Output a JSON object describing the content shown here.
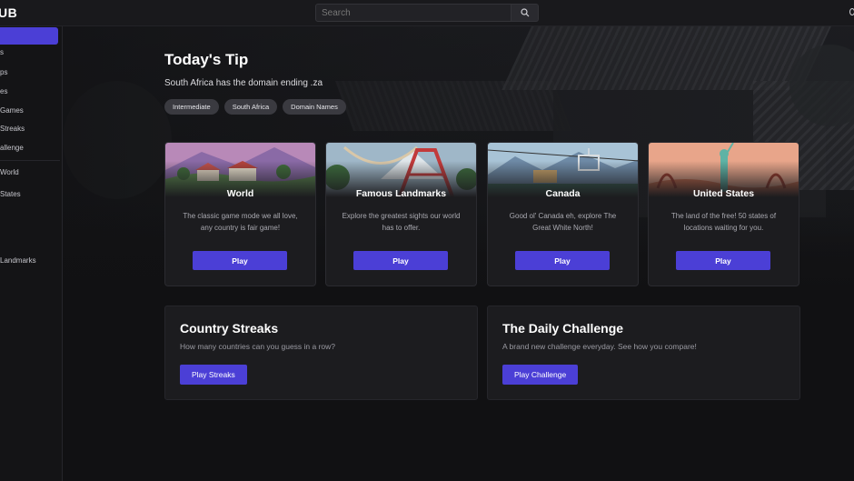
{
  "header": {
    "logo": "UB",
    "search_placeholder": "Search"
  },
  "sidebar": {
    "items": [
      {
        "label": "s"
      },
      {
        "label": "ps"
      },
      {
        "label": "es"
      },
      {
        "label": " Games"
      },
      {
        "label": "Streaks"
      },
      {
        "label": "allenge"
      },
      {
        "label": "World"
      },
      {
        "label": "States"
      },
      {
        "label": " Landmarks"
      }
    ]
  },
  "tip": {
    "title": "Today's Tip",
    "text": "South Africa has the domain ending .za",
    "tags": [
      "Intermediate",
      "South Africa",
      "Domain Names"
    ]
  },
  "modes": [
    {
      "title": "World",
      "description": "The classic game mode we all love, any country is fair game!",
      "button": "Play"
    },
    {
      "title": "Famous Landmarks",
      "description": "Explore the greatest sights our world has to offer.",
      "button": "Play"
    },
    {
      "title": "Canada",
      "description": "Good ol' Canada eh, explore The Great White North!",
      "button": "Play"
    },
    {
      "title": "United States",
      "description": "The land of the free! 50 states of locations waiting for you.",
      "button": "Play"
    }
  ],
  "streaks": {
    "title": "Country Streaks",
    "description": "How many countries can you guess in a row?",
    "button": "Play Streaks"
  },
  "daily": {
    "title": "The Daily Challenge",
    "description": "A brand new challenge everyday. See how you compare!",
    "button": "Play Challenge"
  },
  "colors": {
    "accent": "#4b3fd6",
    "background": "#111113",
    "card": "#1c1c1f"
  }
}
